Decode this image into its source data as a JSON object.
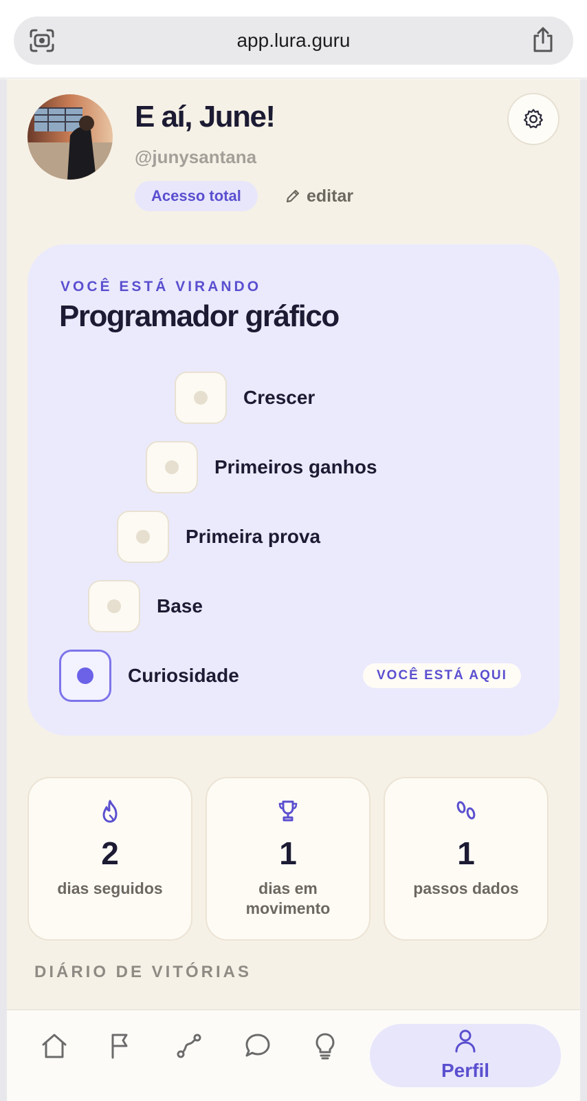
{
  "browser": {
    "url": "app.lura.guru",
    "left_icon": "camera-scan-icon",
    "right_icon": "share-icon"
  },
  "profile": {
    "greeting": "E aí, June!",
    "handle": "@junysantana",
    "badge": "Acesso total",
    "edit_label": "editar",
    "settings_icon": "gear-icon"
  },
  "journey": {
    "eyebrow": "VOCÊ ESTÁ VIRANDO",
    "title": "Programador gráfico",
    "steps": [
      {
        "label": "Crescer",
        "state": "locked"
      },
      {
        "label": "Primeiros ganhos",
        "state": "locked"
      },
      {
        "label": "Primeira prova",
        "state": "locked"
      },
      {
        "label": "Base",
        "state": "locked"
      },
      {
        "label": "Curiosidade",
        "state": "current"
      }
    ],
    "current_badge": "VOCÊ ESTÁ AQUI"
  },
  "stats": [
    {
      "icon": "flame-icon",
      "value": "2",
      "label": "dias seguidos"
    },
    {
      "icon": "trophy-icon",
      "value": "1",
      "label": "dias em movimento"
    },
    {
      "icon": "footprints-icon",
      "value": "1",
      "label": "passos dados"
    }
  ],
  "section_title": "DIÁRIO DE VITÓRIAS",
  "nav": {
    "items": [
      {
        "icon": "home-icon"
      },
      {
        "icon": "flag-icon"
      },
      {
        "icon": "route-icon"
      },
      {
        "icon": "chat-icon"
      },
      {
        "icon": "lightbulb-icon"
      }
    ],
    "active": {
      "icon": "user-icon",
      "label": "Perfil"
    }
  },
  "colors": {
    "accent": "#5a4fcf",
    "background": "#f6f1e6",
    "card": "#ebeafc",
    "text": "#1c1b33"
  }
}
